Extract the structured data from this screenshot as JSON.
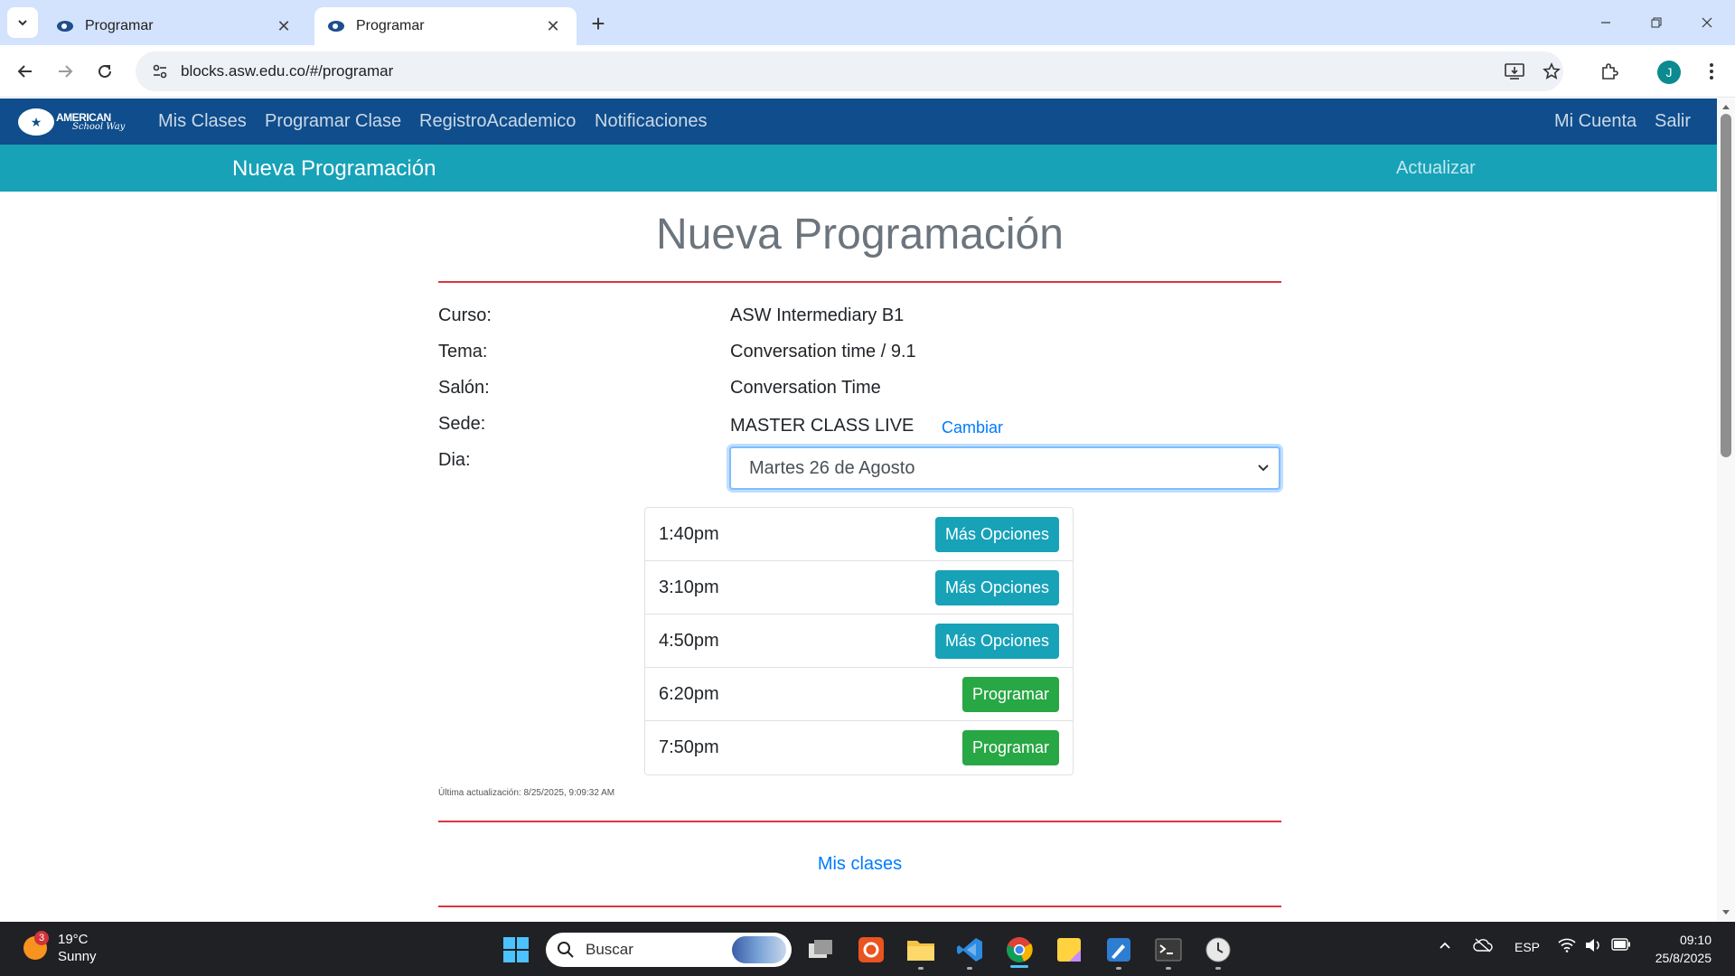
{
  "browser": {
    "tabs": [
      {
        "title": "Programar",
        "active": false
      },
      {
        "title": "Programar",
        "active": true
      }
    ],
    "url": "blocks.asw.edu.co/#/programar",
    "profile_initial": "J"
  },
  "app": {
    "brand": {
      "line1": "AMERICAN",
      "line2": "School Way"
    },
    "nav": {
      "mis_clases": "Mis Clases",
      "programar_clase": "Programar Clase",
      "registro_academico": "RegistroAcademico",
      "notificaciones": "Notificaciones",
      "mi_cuenta": "Mi Cuenta",
      "salir": "Salir"
    },
    "subbar": {
      "title": "Nueva Programación",
      "refresh": "Actualizar"
    }
  },
  "form": {
    "page_title": "Nueva Programación",
    "rows": [
      {
        "label": "Curso:",
        "value": "ASW Intermediary B1"
      },
      {
        "label": "Tema:",
        "value": "Conversation time / 9.1"
      },
      {
        "label": "Salón:",
        "value": "Conversation Time"
      },
      {
        "label": "Sede:",
        "value": "MASTER CLASS LIVE"
      },
      {
        "label": "Dia:"
      }
    ],
    "change_link": "Cambiar",
    "selected_day": "Martes 26 de Agosto",
    "slots": [
      {
        "time": "1:40pm",
        "action": "Más Opciones",
        "style": "info"
      },
      {
        "time": "3:10pm",
        "action": "Más Opciones",
        "style": "info"
      },
      {
        "time": "4:50pm",
        "action": "Más Opciones",
        "style": "info"
      },
      {
        "time": "6:20pm",
        "action": "Programar",
        "style": "success"
      },
      {
        "time": "7:50pm",
        "action": "Programar",
        "style": "success"
      }
    ],
    "last_update": "Última actualización: 8/25/2025, 9:09:32 AM",
    "footer_link": "Mis clases"
  },
  "taskbar": {
    "weather": {
      "badge": "3",
      "temp": "19°C",
      "condition": "Sunny"
    },
    "search_placeholder": "Buscar",
    "language": "ESP",
    "time": "09:10",
    "date": "25/8/2025"
  },
  "colors": {
    "navbar": "#0f4d8c",
    "subbar": "#17a2b8",
    "divider": "#dc3545",
    "link": "#007bff",
    "btn_info": "#17a2b8",
    "btn_success": "#28a745"
  }
}
